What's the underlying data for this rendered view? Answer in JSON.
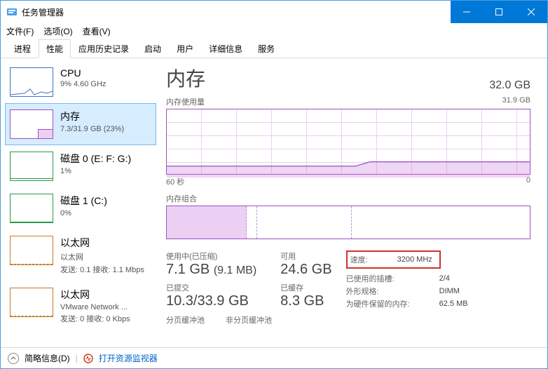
{
  "window": {
    "title": "任务管理器"
  },
  "menu": {
    "file": "文件(F)",
    "options": "选项(O)",
    "view": "查看(V)"
  },
  "tabs": [
    "进程",
    "性能",
    "应用历史记录",
    "启动",
    "用户",
    "详细信息",
    "服务"
  ],
  "active_tab": 1,
  "sidebar": {
    "items": [
      {
        "title": "CPU",
        "sub": "9% 4.60 GHz"
      },
      {
        "title": "内存",
        "sub": "7.3/31.9 GB (23%)"
      },
      {
        "title": "磁盘 0 (E: F: G:)",
        "sub": "1%"
      },
      {
        "title": "磁盘 1 (C:)",
        "sub": "0%"
      },
      {
        "title": "以太网",
        "sub1": "以太网",
        "sub2": "发送: 0.1 接收: 1.1 Mbps"
      },
      {
        "title": "以太网",
        "sub1": "VMware Network ...",
        "sub2": "发送: 0 接收: 0 Kbps"
      }
    ]
  },
  "detail": {
    "title": "内存",
    "total": "32.0 GB",
    "usage_label": "内存使用量",
    "usage_max": "31.9 GB",
    "axis_left": "60 秒",
    "axis_right": "0",
    "comp_label": "内存组合",
    "stats": {
      "in_use_label": "使用中(已压缩)",
      "in_use_value": "7.1 GB",
      "in_use_compressed": "(9.1 MB)",
      "available_label": "可用",
      "available_value": "24.6 GB",
      "committed_label": "已提交",
      "committed_value": "10.3/33.9 GB",
      "cached_label": "已缓存",
      "cached_value": "8.3 GB",
      "paged_label": "分页缓冲池",
      "nonpaged_label": "非分页缓冲池"
    },
    "spec": {
      "speed_label": "速度:",
      "speed_value": "3200 MHz",
      "slots_label": "已使用的插槽:",
      "slots_value": "2/4",
      "form_label": "外形规格:",
      "form_value": "DIMM",
      "reserved_label": "为硬件保留的内存:",
      "reserved_value": "62.5 MB"
    }
  },
  "footer": {
    "brief": "简略信息(D)",
    "resmon": "打开资源监视器"
  }
}
